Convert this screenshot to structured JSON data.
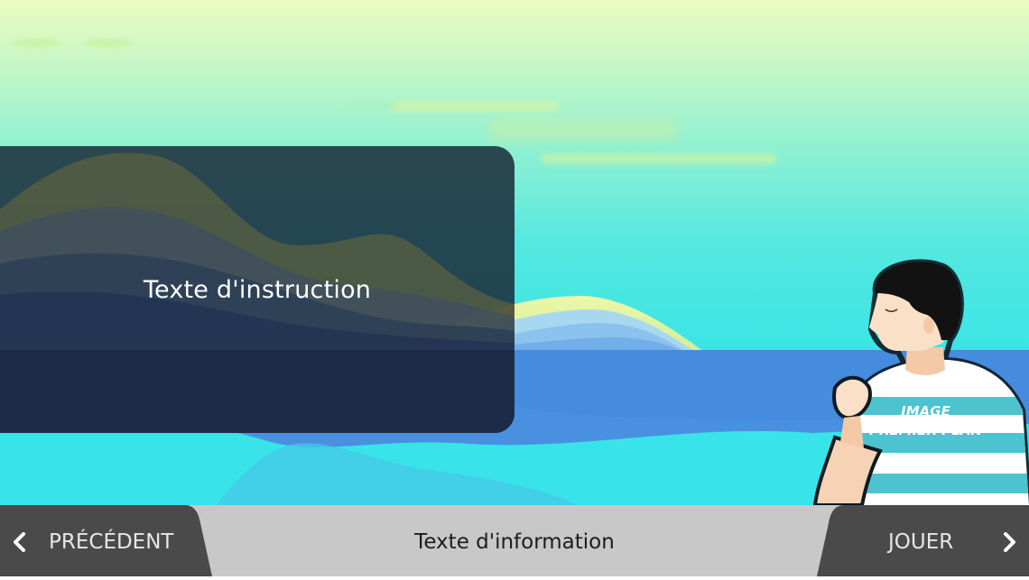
{
  "instruction": {
    "text": "Texte d'instruction"
  },
  "foreground_image": {
    "line1": "IMAGE",
    "line2": "PREMIER PLAN"
  },
  "bottom_bar": {
    "prev_label": "PRÉCÉDENT",
    "info_text": "Texte d'information",
    "next_label": "JOUER",
    "prev_icon": "chevron-left-icon",
    "next_icon": "chevron-right-icon"
  },
  "colors": {
    "sky_top": "#eafcbf",
    "sky_bottom": "#38e5ea",
    "sea": "#4a90e0",
    "panel": "#1b2b3a",
    "bottom_bar": "#c8c8c8",
    "nav_tab": "#4a4a4a",
    "stripe": "#4cc3cf"
  }
}
